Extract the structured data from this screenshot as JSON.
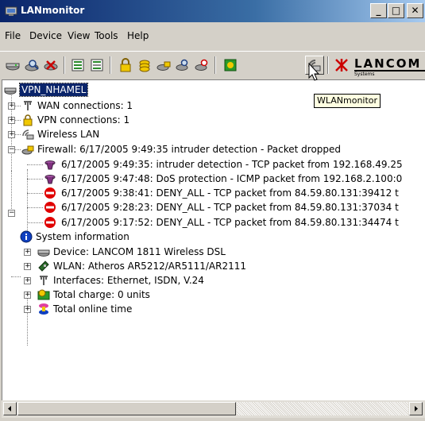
{
  "window": {
    "title": "LANmonitor",
    "min_label": "_",
    "max_label": "□",
    "close_label": "✕"
  },
  "menu": [
    "File",
    "Device",
    "View",
    "Tools",
    "Help"
  ],
  "toolbar": {
    "tooltip": "WLANmonitor",
    "logo_text": "LANCOM",
    "logo_sub": "Systems"
  },
  "tree": {
    "root": "VPN_NHAMEL",
    "wan": "WAN connections: 1",
    "vpn": "VPN connections: 1",
    "wlan": "Wireless LAN",
    "firewall": "Firewall: 6/17/2005 9:49:35 intruder detection - Packet dropped",
    "fw_events": [
      "6/17/2005 9:49:35: intruder detection - TCP packet from 192.168.49.25",
      "6/17/2005 9:47:48: DoS protection - ICMP packet from 192.168.2.100:0",
      "6/17/2005 9:38:41: DENY_ALL - TCP packet from 84.59.80.131:39412 t",
      "6/17/2005 9:28:23: DENY_ALL - TCP packet from 84.59.80.131:37034 t",
      "6/17/2005 9:17:52: DENY_ALL - TCP packet from 84.59.80.131:34474 t"
    ],
    "sysinfo": "System information",
    "device": "Device: LANCOM 1811 Wireless DSL",
    "wlan_chip": "WLAN: Atheros AR5212/AR5111/AR2111",
    "interfaces": "Interfaces: Ethernet, ISDN, V.24",
    "charge": "Total charge: 0 units",
    "online": "Total online time"
  }
}
